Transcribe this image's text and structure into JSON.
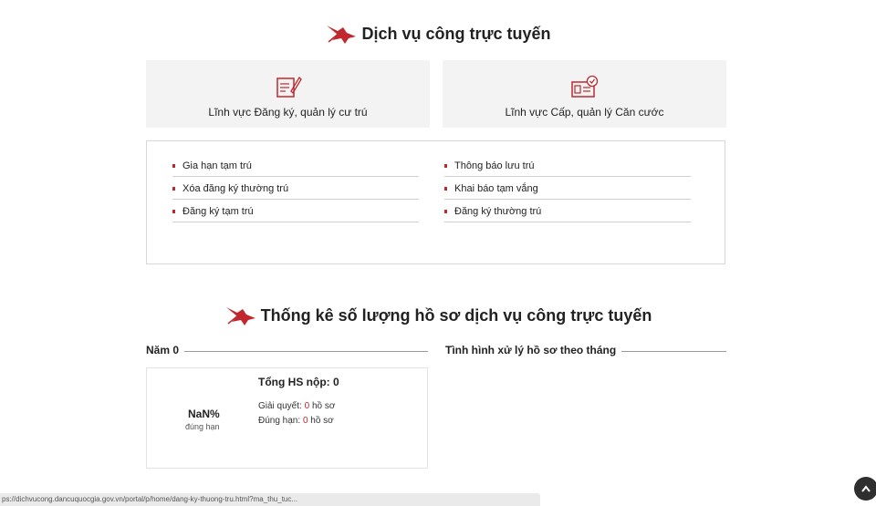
{
  "services": {
    "title": "Dịch vụ công trực tuyến",
    "cards": [
      {
        "label": "Lĩnh vực Đăng ký, quản lý cư trú",
        "icon": "document-sign-icon"
      },
      {
        "label": "Lĩnh vực Cấp, quản lý Căn cước",
        "icon": "id-card-check-icon"
      }
    ],
    "left_items": [
      "Gia hạn tạm trú",
      "Xóa đăng ký thường trú",
      "Đăng ký tạm trú"
    ],
    "right_items": [
      "Thông báo lưu trú",
      "Khai báo tạm vắng",
      "Đăng ký thường trú"
    ]
  },
  "stats": {
    "title": "Thống kê số lượng hồ sơ dịch vụ công trực tuyến",
    "year_label": "Năm 0",
    "monthly_label": "Tình hình xử lý hồ sơ theo tháng",
    "percent": "NaN%",
    "percent_caption": "đúng hạn",
    "total": "Tổng HS nộp: 0",
    "resolved_label": "Giải quyết:",
    "resolved_value": "0",
    "ontime_label": "Đúng hạn:",
    "ontime_value": "0",
    "unit": "hồ sơ"
  },
  "status_bar": {
    "url": "ps://dichvucong.dancuquocgia.gov.vn/portal/p/home/dang-ky-thuong-tru.html?ma_thu_tuc..."
  },
  "colors": {
    "accent": "#c0282e"
  }
}
